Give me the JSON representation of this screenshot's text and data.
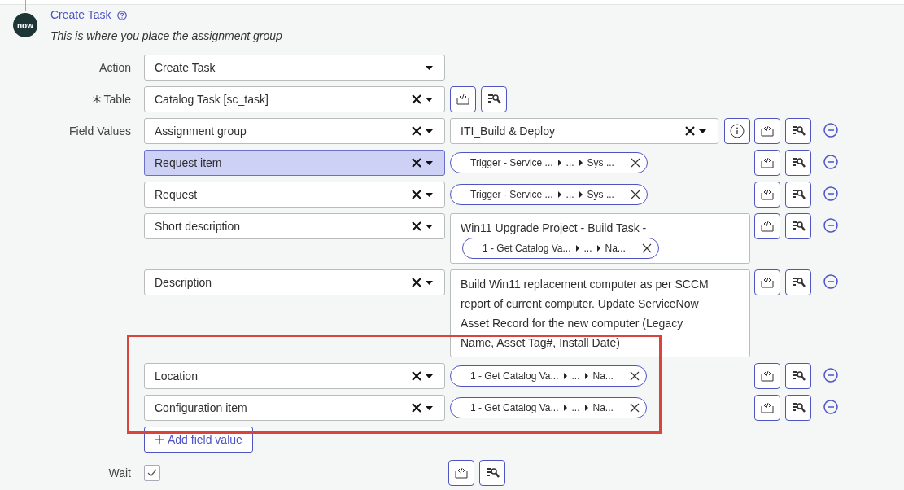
{
  "header": {
    "logo": "now",
    "title": "Create Task",
    "subtitle": "This is where you place the assignment group"
  },
  "action": {
    "label": "Action",
    "value": "Create Task"
  },
  "table": {
    "label": "Table",
    "required": true,
    "value": "Catalog Task [sc_task]"
  },
  "field_values": {
    "label": "Field Values",
    "rows": [
      {
        "field": "Assignment group",
        "selected": false,
        "value": {
          "kind": "select",
          "text": "ITI_Build & Deploy"
        }
      },
      {
        "field": "Request item",
        "selected": true,
        "value": {
          "kind": "pill",
          "segments": [
            "Trigger - Service ...",
            "...",
            "Sys ..."
          ]
        }
      },
      {
        "field": "Request",
        "selected": false,
        "value": {
          "kind": "pill",
          "segments": [
            "Trigger - Service ...",
            "...",
            "Sys ..."
          ]
        }
      },
      {
        "field": "Short description",
        "selected": false,
        "value": {
          "kind": "text",
          "text": "Win11 Upgrade Project - Build Task -",
          "segments": [
            "1 - Get Catalog Va...",
            "...",
            "Na..."
          ]
        }
      },
      {
        "field": "Description",
        "selected": false,
        "value": {
          "kind": "textarea",
          "text": "Build Win11 replacement computer as per SCCM report of current computer. Update ServiceNow Asset Record for the new computer (Legacy Name, Asset Tag#, Install Date)"
        }
      },
      {
        "field": "Location",
        "selected": false,
        "value": {
          "kind": "pill",
          "segments": [
            "1 - Get Catalog Va...",
            "...",
            "Na..."
          ]
        }
      },
      {
        "field": "Configuration item",
        "selected": false,
        "value": {
          "kind": "pill",
          "segments": [
            "1 - Get Catalog Va...",
            "...",
            "Na..."
          ]
        }
      }
    ],
    "add_button": "Add field value"
  },
  "wait": {
    "label": "Wait",
    "checked": true
  }
}
